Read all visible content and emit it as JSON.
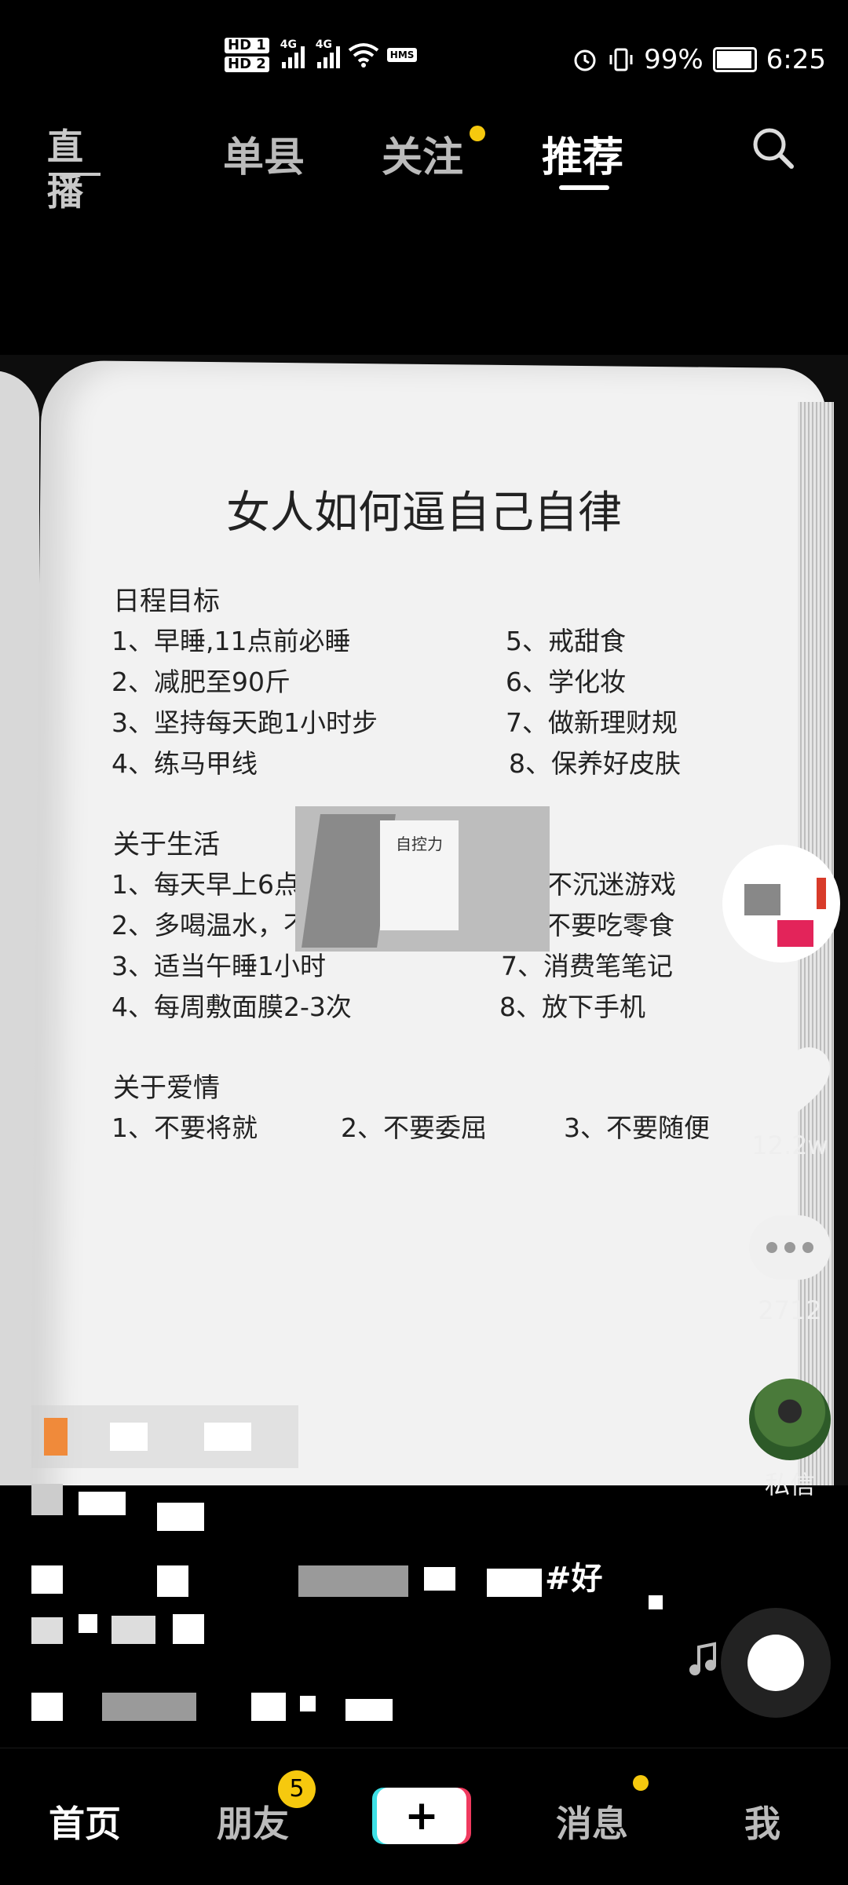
{
  "status_bar": {
    "hd1": "HD 1",
    "hd2": "HD 2",
    "net1": "4G",
    "net2": "4G",
    "hms": "HMS",
    "battery": "99%",
    "time": "6:25"
  },
  "top_nav": {
    "live_label": "直播",
    "tabs": [
      {
        "label": "单县"
      },
      {
        "label": "关注"
      },
      {
        "label": "推荐"
      }
    ],
    "active_tab": "推荐"
  },
  "book": {
    "title": "女人如何逼自己自律",
    "sections": [
      {
        "title": "日程目标",
        "left": [
          "1、早睡,11点前必睡",
          "2、减肥至90斤",
          "3、坚持每天跑1小时步",
          "4、练马甲线"
        ],
        "right": [
          "5、戒甜食",
          "6、学化妆",
          "7、做新理财规",
          "8、保养好皮肤"
        ]
      },
      {
        "title": "关于生活",
        "left": [
          "1、每天早上6点30起",
          "2、多喝温水，不喝饮料",
          "3、适当午睡1小时",
          "4、每周敷面膜2-3次"
        ],
        "right": [
          "5、不沉迷游戏",
          "6、不要吃零食",
          "7、消费笔笔记",
          "8、放下手机"
        ]
      },
      {
        "title": "关于爱情",
        "items": [
          "1、不要将就",
          "2、不要委屈",
          "3、不要随便"
        ]
      }
    ],
    "thumbnail_title": "自控力"
  },
  "side_actions": {
    "likes": "12.2w",
    "comments": "2712",
    "dm_label": "私信"
  },
  "caption": {
    "visible_fragment": "#好"
  },
  "bottom_nav": {
    "home": "首页",
    "friends": "朋友",
    "friends_badge": "5",
    "plus": "+",
    "messages": "消息",
    "me": "我"
  },
  "colors": {
    "accent_yellow": "#f6c90e",
    "plus_cyan": "#3ee0e6",
    "plus_red": "#f03a5f"
  }
}
